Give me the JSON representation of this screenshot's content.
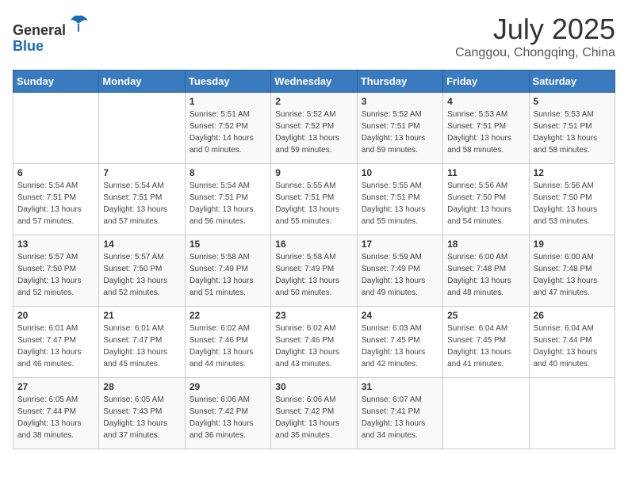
{
  "header": {
    "logo_line1": "General",
    "logo_line2": "Blue",
    "month": "July 2025",
    "location": "Canggou, Chongqing, China"
  },
  "weekdays": [
    "Sunday",
    "Monday",
    "Tuesday",
    "Wednesday",
    "Thursday",
    "Friday",
    "Saturday"
  ],
  "weeks": [
    [
      {
        "day": "",
        "sunrise": "",
        "sunset": "",
        "daylight": ""
      },
      {
        "day": "",
        "sunrise": "",
        "sunset": "",
        "daylight": ""
      },
      {
        "day": "1",
        "sunrise": "Sunrise: 5:51 AM",
        "sunset": "Sunset: 7:52 PM",
        "daylight": "Daylight: 14 hours and 0 minutes."
      },
      {
        "day": "2",
        "sunrise": "Sunrise: 5:52 AM",
        "sunset": "Sunset: 7:52 PM",
        "daylight": "Daylight: 13 hours and 59 minutes."
      },
      {
        "day": "3",
        "sunrise": "Sunrise: 5:52 AM",
        "sunset": "Sunset: 7:51 PM",
        "daylight": "Daylight: 13 hours and 59 minutes."
      },
      {
        "day": "4",
        "sunrise": "Sunrise: 5:53 AM",
        "sunset": "Sunset: 7:51 PM",
        "daylight": "Daylight: 13 hours and 58 minutes."
      },
      {
        "day": "5",
        "sunrise": "Sunrise: 5:53 AM",
        "sunset": "Sunset: 7:51 PM",
        "daylight": "Daylight: 13 hours and 58 minutes."
      }
    ],
    [
      {
        "day": "6",
        "sunrise": "Sunrise: 5:54 AM",
        "sunset": "Sunset: 7:51 PM",
        "daylight": "Daylight: 13 hours and 57 minutes."
      },
      {
        "day": "7",
        "sunrise": "Sunrise: 5:54 AM",
        "sunset": "Sunset: 7:51 PM",
        "daylight": "Daylight: 13 hours and 57 minutes."
      },
      {
        "day": "8",
        "sunrise": "Sunrise: 5:54 AM",
        "sunset": "Sunset: 7:51 PM",
        "daylight": "Daylight: 13 hours and 56 minutes."
      },
      {
        "day": "9",
        "sunrise": "Sunrise: 5:55 AM",
        "sunset": "Sunset: 7:51 PM",
        "daylight": "Daylight: 13 hours and 55 minutes."
      },
      {
        "day": "10",
        "sunrise": "Sunrise: 5:55 AM",
        "sunset": "Sunset: 7:51 PM",
        "daylight": "Daylight: 13 hours and 55 minutes."
      },
      {
        "day": "11",
        "sunrise": "Sunrise: 5:56 AM",
        "sunset": "Sunset: 7:50 PM",
        "daylight": "Daylight: 13 hours and 54 minutes."
      },
      {
        "day": "12",
        "sunrise": "Sunrise: 5:56 AM",
        "sunset": "Sunset: 7:50 PM",
        "daylight": "Daylight: 13 hours and 53 minutes."
      }
    ],
    [
      {
        "day": "13",
        "sunrise": "Sunrise: 5:57 AM",
        "sunset": "Sunset: 7:50 PM",
        "daylight": "Daylight: 13 hours and 52 minutes."
      },
      {
        "day": "14",
        "sunrise": "Sunrise: 5:57 AM",
        "sunset": "Sunset: 7:50 PM",
        "daylight": "Daylight: 13 hours and 52 minutes."
      },
      {
        "day": "15",
        "sunrise": "Sunrise: 5:58 AM",
        "sunset": "Sunset: 7:49 PM",
        "daylight": "Daylight: 13 hours and 51 minutes."
      },
      {
        "day": "16",
        "sunrise": "Sunrise: 5:58 AM",
        "sunset": "Sunset: 7:49 PM",
        "daylight": "Daylight: 13 hours and 50 minutes."
      },
      {
        "day": "17",
        "sunrise": "Sunrise: 5:59 AM",
        "sunset": "Sunset: 7:49 PM",
        "daylight": "Daylight: 13 hours and 49 minutes."
      },
      {
        "day": "18",
        "sunrise": "Sunrise: 6:00 AM",
        "sunset": "Sunset: 7:48 PM",
        "daylight": "Daylight: 13 hours and 48 minutes."
      },
      {
        "day": "19",
        "sunrise": "Sunrise: 6:00 AM",
        "sunset": "Sunset: 7:48 PM",
        "daylight": "Daylight: 13 hours and 47 minutes."
      }
    ],
    [
      {
        "day": "20",
        "sunrise": "Sunrise: 6:01 AM",
        "sunset": "Sunset: 7:47 PM",
        "daylight": "Daylight: 13 hours and 46 minutes."
      },
      {
        "day": "21",
        "sunrise": "Sunrise: 6:01 AM",
        "sunset": "Sunset: 7:47 PM",
        "daylight": "Daylight: 13 hours and 45 minutes."
      },
      {
        "day": "22",
        "sunrise": "Sunrise: 6:02 AM",
        "sunset": "Sunset: 7:46 PM",
        "daylight": "Daylight: 13 hours and 44 minutes."
      },
      {
        "day": "23",
        "sunrise": "Sunrise: 6:02 AM",
        "sunset": "Sunset: 7:46 PM",
        "daylight": "Daylight: 13 hours and 43 minutes."
      },
      {
        "day": "24",
        "sunrise": "Sunrise: 6:03 AM",
        "sunset": "Sunset: 7:45 PM",
        "daylight": "Daylight: 13 hours and 42 minutes."
      },
      {
        "day": "25",
        "sunrise": "Sunrise: 6:04 AM",
        "sunset": "Sunset: 7:45 PM",
        "daylight": "Daylight: 13 hours and 41 minutes."
      },
      {
        "day": "26",
        "sunrise": "Sunrise: 6:04 AM",
        "sunset": "Sunset: 7:44 PM",
        "daylight": "Daylight: 13 hours and 40 minutes."
      }
    ],
    [
      {
        "day": "27",
        "sunrise": "Sunrise: 6:05 AM",
        "sunset": "Sunset: 7:44 PM",
        "daylight": "Daylight: 13 hours and 38 minutes."
      },
      {
        "day": "28",
        "sunrise": "Sunrise: 6:05 AM",
        "sunset": "Sunset: 7:43 PM",
        "daylight": "Daylight: 13 hours and 37 minutes."
      },
      {
        "day": "29",
        "sunrise": "Sunrise: 6:06 AM",
        "sunset": "Sunset: 7:42 PM",
        "daylight": "Daylight: 13 hours and 36 minutes."
      },
      {
        "day": "30",
        "sunrise": "Sunrise: 6:06 AM",
        "sunset": "Sunset: 7:42 PM",
        "daylight": "Daylight: 13 hours and 35 minutes."
      },
      {
        "day": "31",
        "sunrise": "Sunrise: 6:07 AM",
        "sunset": "Sunset: 7:41 PM",
        "daylight": "Daylight: 13 hours and 34 minutes."
      },
      {
        "day": "",
        "sunrise": "",
        "sunset": "",
        "daylight": ""
      },
      {
        "day": "",
        "sunrise": "",
        "sunset": "",
        "daylight": ""
      }
    ]
  ]
}
